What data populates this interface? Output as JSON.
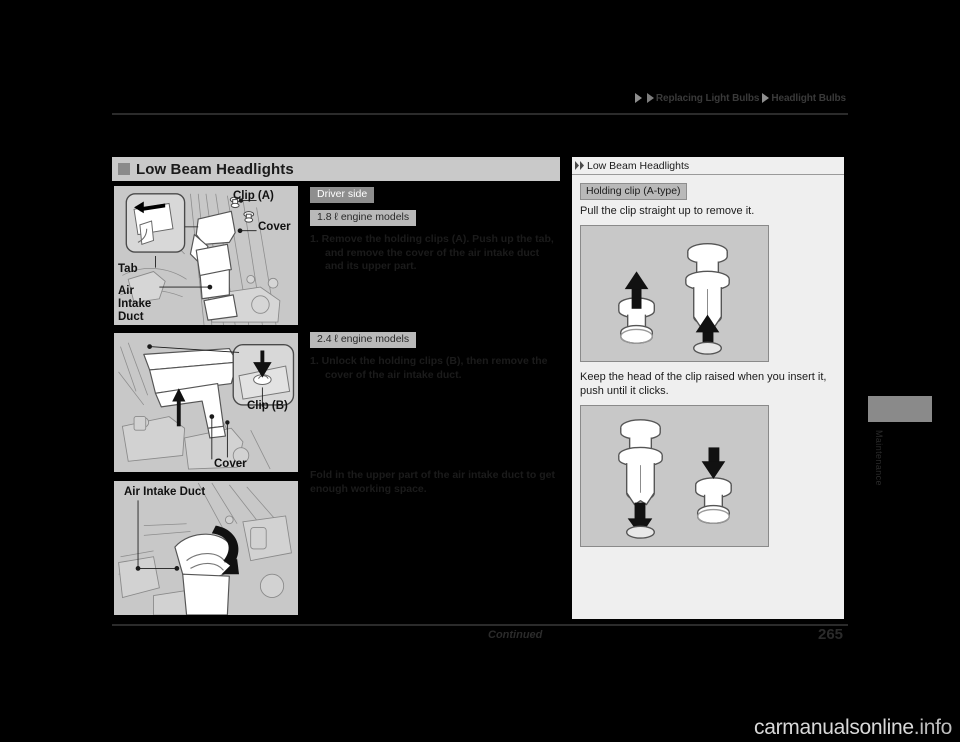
{
  "header": {
    "breadcrumb": [
      {
        "label": "Replacing Light Bulbs"
      },
      {
        "label": "Headlight Bulbs"
      }
    ]
  },
  "section": {
    "title": "Low Beam Headlights",
    "bullet_icon": "filled-square-icon"
  },
  "illustrations": {
    "panel1": {
      "name": "driver-side-air-intake-duct-figure",
      "labels": {
        "clip_a": "Clip (A)",
        "cover": "Cover",
        "tab": "Tab",
        "air_intake_duct": "Air\nIntake\nDuct"
      }
    },
    "panel2": {
      "name": "cover-removal-figure",
      "labels": {
        "clip_b": "Clip (B)",
        "cover": "Cover"
      }
    },
    "panel3": {
      "name": "fold-air-intake-duct-figure",
      "labels": {
        "air_intake_duct": "Air Intake Duct"
      }
    }
  },
  "instructions": {
    "driver_side_tag": "Driver side",
    "engine_18_tag": "1.8 ℓ engine models",
    "step_18": "1. Remove the holding clips (A). Push up the tab, and remove the cover of the air intake duct and its upper part.",
    "engine_24_tag": "2.4 ℓ engine models",
    "step_24": "1. Unlock the holding clips (B), then remove the cover of the air intake duct.",
    "fold_note": "Fold in the upper part of the air intake duct to get enough working space."
  },
  "sidebar_note": {
    "arrow_icon": "double-chevron-right-icon",
    "title": "Low Beam Headlights",
    "clip_tag": "Holding clip (A-type)",
    "remove_text": "Pull the clip straight up to remove it.",
    "insert_text": "Keep the head of the clip raised when you insert it, push until it clicks.",
    "figure_remove_name": "clip-remove-figure",
    "figure_insert_name": "clip-insert-figure"
  },
  "side_tab": {
    "label": "Maintenance"
  },
  "footer": {
    "continued": "Continued",
    "page_number": "265"
  },
  "watermark": {
    "text_main": "carmanualsonline",
    "text_dim": ".info"
  },
  "colors": {
    "page_background": "#000000",
    "panel_fill": "#c8c8c8",
    "title_bar": "#c9c9c9",
    "tag_dark": "#8e8e8e",
    "tag_light": "#b9b9b9",
    "note_box": "#efefef",
    "rule": "#2b2b2b"
  }
}
